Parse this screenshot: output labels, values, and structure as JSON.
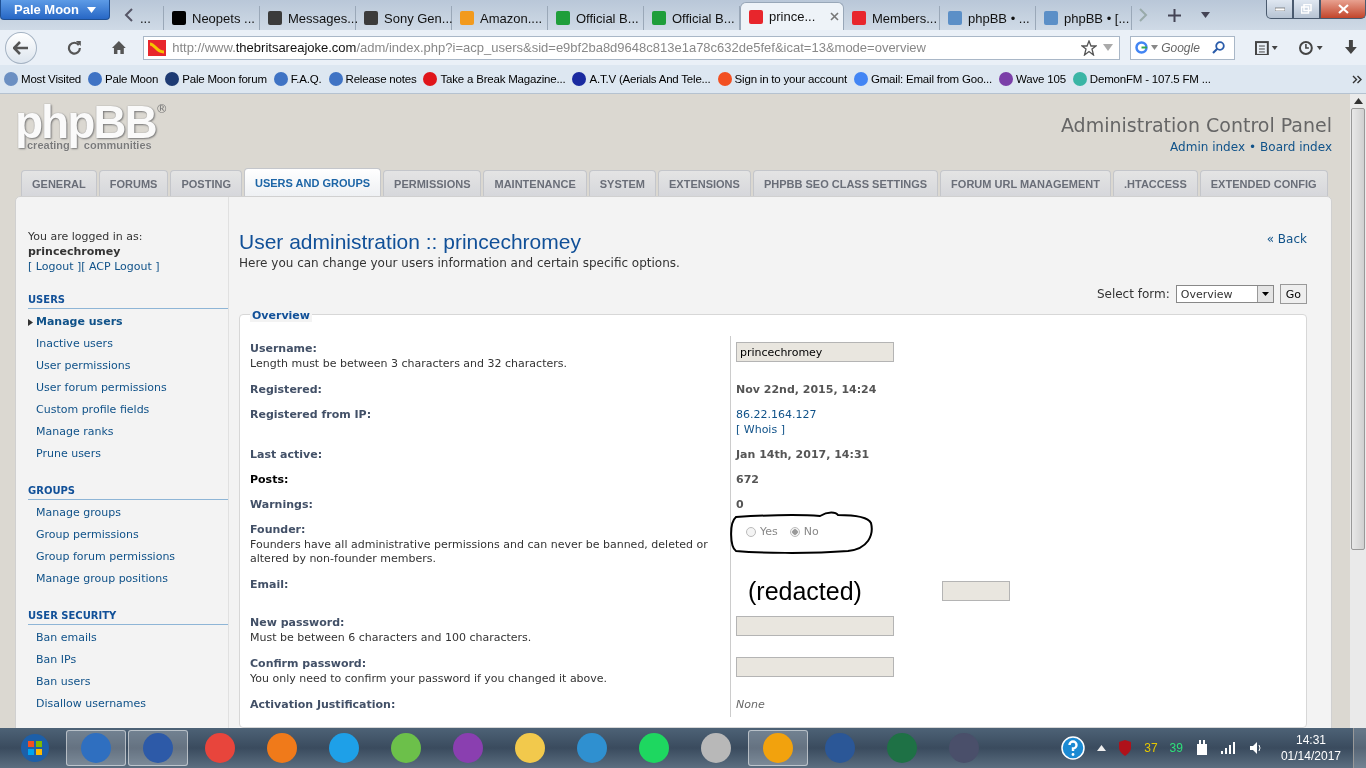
{
  "browser": {
    "menu_button": "Pale Moon",
    "tabs": [
      {
        "title": "...",
        "selected": false
      },
      {
        "title": "Neopets ...",
        "selected": false,
        "color": "#000000"
      },
      {
        "title": "Messages...",
        "selected": false,
        "color": "#3b3b3b"
      },
      {
        "title": "Sony Gen...",
        "selected": false,
        "color": "#3b3b3b"
      },
      {
        "title": "Amazon....",
        "selected": false,
        "color": "#f29a1d"
      },
      {
        "title": "Official B...",
        "selected": false,
        "color": "#1f9e3a"
      },
      {
        "title": "Official B...",
        "selected": false,
        "color": "#1f9e3a"
      },
      {
        "title": "prince...",
        "selected": true,
        "color": "#e8262c"
      },
      {
        "title": "Members...",
        "selected": false,
        "color": "#e8262c"
      },
      {
        "title": "phpBB • ...",
        "selected": false,
        "color": "#5b8fc7"
      },
      {
        "title": "phpBB • [...",
        "selected": false,
        "color": "#5b8fc7"
      }
    ],
    "url": "http://www.**thebritsareajoke.com**/adm/index.php?i=acp_users&sid=e9bf2ba8d9648c813e1a78c632de5fef&icat=13&mode=overview",
    "search_placeholder": "Google",
    "bookmarks": [
      {
        "label": "Most Visited",
        "color": "#6b8fc2"
      },
      {
        "label": "Pale Moon",
        "color": "#3f73c4"
      },
      {
        "label": "Pale Moon forum",
        "color": "#1d3a73"
      },
      {
        "label": "F.A.Q.",
        "color": "#3f73c4"
      },
      {
        "label": "Release notes",
        "color": "#3f73c4"
      },
      {
        "label": "Take a Break Magazine...",
        "color": "#e0151b"
      },
      {
        "label": "A.T.V (Aerials And Tele...",
        "color": "#1a2aa0"
      },
      {
        "label": "Sign in to your account",
        "color": "#f25022"
      },
      {
        "label": "Gmail: Email from Goo...",
        "color": "#4285f4"
      },
      {
        "label": "Wave 105",
        "color": "#7b3fa8"
      },
      {
        "label": "DemonFM - 107.5 FM ...",
        "color": "#3ab5a5"
      }
    ]
  },
  "page": {
    "logo": {
      "wordmark": "phpBB",
      "mark": "®",
      "tagline": [
        "creating",
        "communities"
      ]
    },
    "title": "Administration Control Panel",
    "header_links": [
      "Admin index",
      "•",
      "Board index"
    ],
    "tabs": [
      {
        "label": "GENERAL",
        "selected": false
      },
      {
        "label": "FORUMS",
        "selected": false
      },
      {
        "label": "POSTING",
        "selected": false
      },
      {
        "label": "USERS AND GROUPS",
        "selected": true
      },
      {
        "label": "PERMISSIONS",
        "selected": false
      },
      {
        "label": "MAINTENANCE",
        "selected": false
      },
      {
        "label": "SYSTEM",
        "selected": false
      },
      {
        "label": "EXTENSIONS",
        "selected": false
      },
      {
        "label": "PHPBB SEO CLASS SETTINGS",
        "selected": false
      },
      {
        "label": "FORUM URL MANAGEMENT",
        "selected": false
      },
      {
        "label": ".HTACCESS",
        "selected": false
      },
      {
        "label": "EXTENDED CONFIG",
        "selected": false
      }
    ],
    "sidebar": {
      "logged_in_label": "You are logged in as:",
      "username": "princechromey",
      "links": [
        "[ Logout ]",
        "[ ACP Logout ]"
      ],
      "sections": [
        {
          "heading": "USERS",
          "items": [
            {
              "label": "Manage users",
              "selected": true
            },
            {
              "label": "Inactive users",
              "selected": false
            },
            {
              "label": "User permissions",
              "selected": false
            },
            {
              "label": "User forum permissions",
              "selected": false
            },
            {
              "label": "Custom profile fields",
              "selected": false
            },
            {
              "label": "Manage ranks",
              "selected": false
            },
            {
              "label": "Prune users",
              "selected": false
            }
          ]
        },
        {
          "heading": "GROUPS",
          "items": [
            {
              "label": "Manage groups",
              "selected": false
            },
            {
              "label": "Group permissions",
              "selected": false
            },
            {
              "label": "Group forum permissions",
              "selected": false
            },
            {
              "label": "Manage group positions",
              "selected": false
            }
          ]
        },
        {
          "heading": "USER SECURITY",
          "items": [
            {
              "label": "Ban emails",
              "selected": false
            },
            {
              "label": "Ban IPs",
              "selected": false
            },
            {
              "label": "Ban users",
              "selected": false
            },
            {
              "label": "Disallow usernames",
              "selected": false
            }
          ]
        }
      ]
    },
    "main": {
      "heading": "User administration :: princechromey",
      "description": "Here you can change your users information and certain specific options.",
      "back_link": "« Back",
      "select_form": {
        "label": "Select form:",
        "value": "Overview",
        "button": "Go"
      },
      "legend": "Overview",
      "rows": [
        {
          "label": "Username:",
          "explain": "Length must be between 3 characters and 32 characters.",
          "kind": "input",
          "value": "princechromey"
        },
        {
          "label": "Registered:",
          "kind": "text",
          "value": "Nov 22nd, 2015, 14:24"
        },
        {
          "label": "Registered from IP:",
          "kind": "links",
          "links": [
            "86.22.164.127",
            "[ Whois ]"
          ]
        },
        {
          "label": "Last active:",
          "kind": "text",
          "value": "Jan 14th, 2017, 14:31"
        },
        {
          "label": "Posts:",
          "kind": "link",
          "value": "672"
        },
        {
          "label": "Warnings:",
          "kind": "text",
          "value": "0"
        },
        {
          "label": "Founder:",
          "explain": "Founders have all administrative permissions and can never be banned, deleted or altered by non-founder members.",
          "kind": "radio",
          "options": [
            {
              "label": "Yes",
              "selected": false
            },
            {
              "label": "No",
              "selected": true
            }
          ]
        },
        {
          "label": "Email:",
          "kind": "redacted",
          "value": "(redacted)"
        },
        {
          "label": "New password:",
          "explain": "Must be between 6 characters and 100 characters.",
          "kind": "input"
        },
        {
          "label": "Confirm password:",
          "explain": "You only need to confirm your password if you changed it above.",
          "kind": "input"
        },
        {
          "label": "Activation Justification:",
          "kind": "note",
          "value": "None"
        }
      ]
    }
  },
  "taskbar": {
    "apps": [
      {
        "color": "#2f6fc0",
        "selected": true
      },
      {
        "color": "#2d5aa8",
        "selected": true
      },
      {
        "color": "#e8453c",
        "selected": false
      },
      {
        "color": "#f07a1a",
        "selected": false
      },
      {
        "color": "#1ea0e8",
        "selected": false
      },
      {
        "color": "#6cc04a",
        "selected": false
      },
      {
        "color": "#8a3fb0",
        "selected": false
      },
      {
        "color": "#f2c94c",
        "selected": false
      },
      {
        "color": "#2f90d0",
        "selected": false
      },
      {
        "color": "#1ed760",
        "selected": false
      },
      {
        "color": "#b8b8b8",
        "selected": false
      },
      {
        "color": "#f2a20d",
        "selected": true
      },
      {
        "color": "#2b5797",
        "selected": false
      },
      {
        "color": "#1e7145",
        "selected": false
      },
      {
        "color": "#4a4f6a",
        "selected": false
      }
    ],
    "tray_counts": [
      {
        "value": "37",
        "color": "#e6c700"
      },
      {
        "value": "39",
        "color": "#2ee07a"
      }
    ],
    "time": "14:31",
    "date": "01/14/2017"
  }
}
